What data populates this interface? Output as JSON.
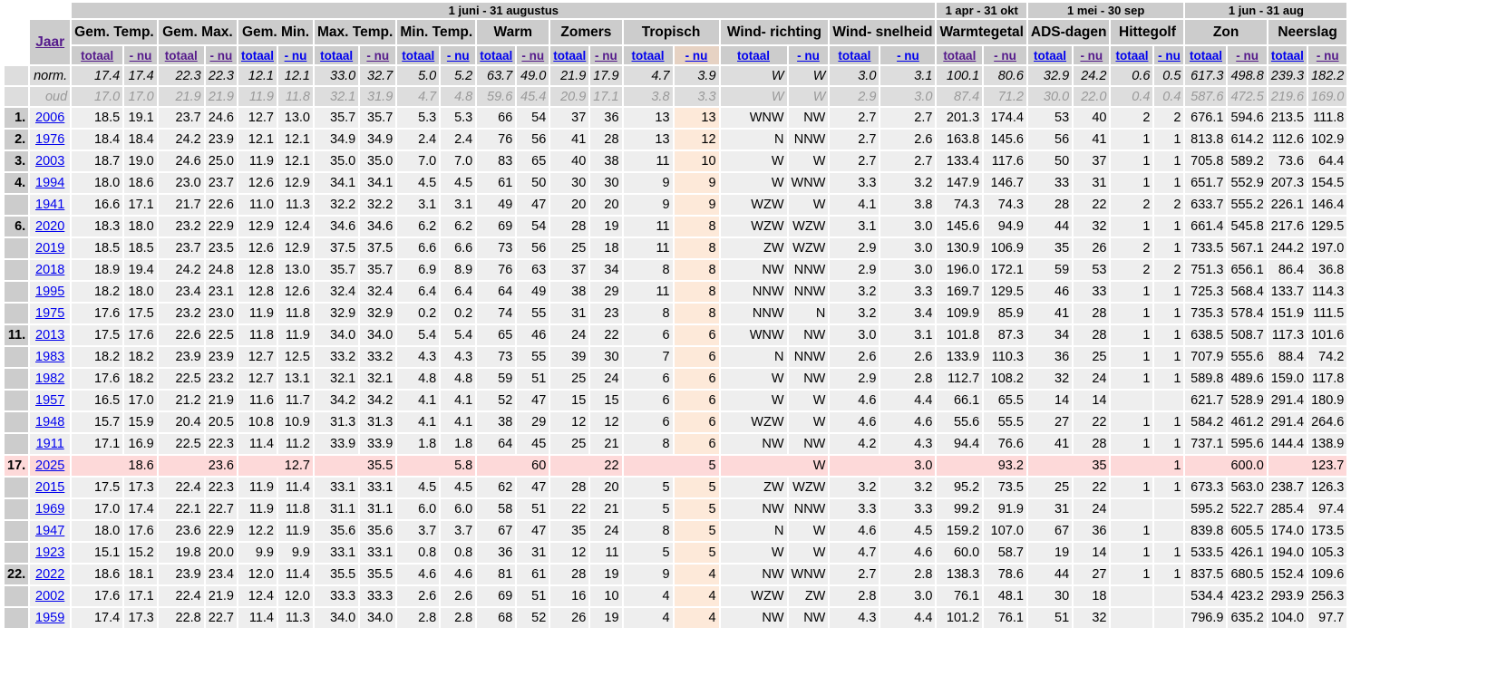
{
  "periods": [
    "1 juni - 31 augustus",
    "1 apr - 31 okt",
    "1 mei - 30 sep",
    "1 jun - 31 aug"
  ],
  "year_header": "Jaar",
  "groups": [
    "Gem. Temp.",
    "Gem. Max.",
    "Gem. Min.",
    "Max. Temp.",
    "Min. Temp.",
    "Warm",
    "Zomers",
    "Tropisch",
    "Wind- richting",
    "Wind- snelheid",
    "Warmtegetal",
    "ADS-dagen",
    "Hittegolf",
    "Zon",
    "Neerslag"
  ],
  "sub_labels": {
    "total": "totaal",
    "now": "- nu"
  },
  "visited_links": [
    [
      true,
      true
    ],
    [
      true,
      true
    ],
    [
      false,
      false
    ],
    [
      false,
      true
    ],
    [
      false,
      false
    ],
    [
      false,
      true
    ],
    [
      false,
      true
    ],
    [
      false,
      false
    ],
    [
      false,
      false
    ],
    [
      false,
      false
    ],
    [
      true,
      true
    ],
    [
      false,
      true
    ],
    [
      false,
      false
    ],
    [
      false,
      true
    ],
    [
      false,
      true
    ]
  ],
  "norm": {
    "label": "norm.",
    "values": [
      "17.4",
      "17.4",
      "22.3",
      "22.3",
      "12.1",
      "12.1",
      "33.0",
      "32.7",
      "5.0",
      "5.2",
      "63.7",
      "49.0",
      "21.9",
      "17.9",
      "4.7",
      "3.9",
      "W",
      "W",
      "3.0",
      "3.1",
      "100.1",
      "80.6",
      "32.9",
      "24.2",
      "0.6",
      "0.5",
      "617.3",
      "498.8",
      "239.3",
      "182.2"
    ]
  },
  "oud": {
    "label": "oud",
    "values": [
      "17.0",
      "17.0",
      "21.9",
      "21.9",
      "11.9",
      "11.8",
      "32.1",
      "31.9",
      "4.7",
      "4.8",
      "59.6",
      "45.4",
      "20.9",
      "17.1",
      "3.8",
      "3.3",
      "W",
      "W",
      "2.9",
      "3.0",
      "87.4",
      "71.2",
      "30.0",
      "22.0",
      "0.4",
      "0.4",
      "587.6",
      "472.5",
      "219.6",
      "169.0"
    ]
  },
  "colors": {
    "header": "#cccccc",
    "row": "#eeeeee",
    "highlight_row": "#fdd9d9",
    "tropisch_now": "#fde9d9"
  },
  "rows": [
    {
      "rank": "1.",
      "year": "2006",
      "values": [
        "18.5",
        "19.1",
        "23.7",
        "24.6",
        "12.7",
        "13.0",
        "35.7",
        "35.7",
        "5.3",
        "5.3",
        "66",
        "54",
        "37",
        "36",
        "13",
        "13",
        "WNW",
        "NW",
        "2.7",
        "2.7",
        "201.3",
        "174.4",
        "53",
        "40",
        "2",
        "2",
        "676.1",
        "594.6",
        "213.5",
        "111.8"
      ]
    },
    {
      "rank": "2.",
      "year": "1976",
      "values": [
        "18.4",
        "18.4",
        "24.2",
        "23.9",
        "12.1",
        "12.1",
        "34.9",
        "34.9",
        "2.4",
        "2.4",
        "76",
        "56",
        "41",
        "28",
        "13",
        "12",
        "N",
        "NNW",
        "2.7",
        "2.6",
        "163.8",
        "145.6",
        "56",
        "41",
        "1",
        "1",
        "813.8",
        "614.2",
        "112.6",
        "102.9"
      ]
    },
    {
      "rank": "3.",
      "year": "2003",
      "values": [
        "18.7",
        "19.0",
        "24.6",
        "25.0",
        "11.9",
        "12.1",
        "35.0",
        "35.0",
        "7.0",
        "7.0",
        "83",
        "65",
        "40",
        "38",
        "11",
        "10",
        "W",
        "W",
        "2.7",
        "2.7",
        "133.4",
        "117.6",
        "50",
        "37",
        "1",
        "1",
        "705.8",
        "589.2",
        "73.6",
        "64.4"
      ]
    },
    {
      "rank": "4.",
      "year": "1994",
      "values": [
        "18.0",
        "18.6",
        "23.0",
        "23.7",
        "12.6",
        "12.9",
        "34.1",
        "34.1",
        "4.5",
        "4.5",
        "61",
        "50",
        "30",
        "30",
        "9",
        "9",
        "W",
        "WNW",
        "3.3",
        "3.2",
        "147.9",
        "146.7",
        "33",
        "31",
        "1",
        "1",
        "651.7",
        "552.9",
        "207.3",
        "154.5"
      ]
    },
    {
      "rank": "",
      "year": "1941",
      "values": [
        "16.6",
        "17.1",
        "21.7",
        "22.6",
        "11.0",
        "11.3",
        "32.2",
        "32.2",
        "3.1",
        "3.1",
        "49",
        "47",
        "20",
        "20",
        "9",
        "9",
        "WZW",
        "W",
        "4.1",
        "3.8",
        "74.3",
        "74.3",
        "28",
        "22",
        "2",
        "2",
        "633.7",
        "555.2",
        "226.1",
        "146.4"
      ]
    },
    {
      "rank": "6.",
      "year": "2020",
      "values": [
        "18.3",
        "18.0",
        "23.2",
        "22.9",
        "12.9",
        "12.4",
        "34.6",
        "34.6",
        "6.2",
        "6.2",
        "69",
        "54",
        "28",
        "19",
        "11",
        "8",
        "WZW",
        "WZW",
        "3.1",
        "3.0",
        "145.6",
        "94.9",
        "44",
        "32",
        "1",
        "1",
        "661.4",
        "545.8",
        "217.6",
        "129.5"
      ]
    },
    {
      "rank": "",
      "year": "2019",
      "values": [
        "18.5",
        "18.5",
        "23.7",
        "23.5",
        "12.6",
        "12.9",
        "37.5",
        "37.5",
        "6.6",
        "6.6",
        "73",
        "56",
        "25",
        "18",
        "11",
        "8",
        "ZW",
        "WZW",
        "2.9",
        "3.0",
        "130.9",
        "106.9",
        "35",
        "26",
        "2",
        "1",
        "733.5",
        "567.1",
        "244.2",
        "197.0"
      ]
    },
    {
      "rank": "",
      "year": "2018",
      "values": [
        "18.9",
        "19.4",
        "24.2",
        "24.8",
        "12.8",
        "13.0",
        "35.7",
        "35.7",
        "6.9",
        "8.9",
        "76",
        "63",
        "37",
        "34",
        "8",
        "8",
        "NW",
        "NNW",
        "2.9",
        "3.0",
        "196.0",
        "172.1",
        "59",
        "53",
        "2",
        "2",
        "751.3",
        "656.1",
        "86.4",
        "36.8"
      ]
    },
    {
      "rank": "",
      "year": "1995",
      "values": [
        "18.2",
        "18.0",
        "23.4",
        "23.1",
        "12.8",
        "12.6",
        "32.4",
        "32.4",
        "6.4",
        "6.4",
        "64",
        "49",
        "38",
        "29",
        "11",
        "8",
        "NNW",
        "NNW",
        "3.2",
        "3.3",
        "169.7",
        "129.5",
        "46",
        "33",
        "1",
        "1",
        "725.3",
        "568.4",
        "133.7",
        "114.3"
      ]
    },
    {
      "rank": "",
      "year": "1975",
      "values": [
        "17.6",
        "17.5",
        "23.2",
        "23.0",
        "11.9",
        "11.8",
        "32.9",
        "32.9",
        "0.2",
        "0.2",
        "74",
        "55",
        "31",
        "23",
        "8",
        "8",
        "NNW",
        "N",
        "3.2",
        "3.4",
        "109.9",
        "85.9",
        "41",
        "28",
        "1",
        "1",
        "735.3",
        "578.4",
        "151.9",
        "111.5"
      ]
    },
    {
      "rank": "11.",
      "year": "2013",
      "values": [
        "17.5",
        "17.6",
        "22.6",
        "22.5",
        "11.8",
        "11.9",
        "34.0",
        "34.0",
        "5.4",
        "5.4",
        "65",
        "46",
        "24",
        "22",
        "6",
        "6",
        "WNW",
        "NW",
        "3.0",
        "3.1",
        "101.8",
        "87.3",
        "34",
        "28",
        "1",
        "1",
        "638.5",
        "508.7",
        "117.3",
        "101.6"
      ]
    },
    {
      "rank": "",
      "year": "1983",
      "values": [
        "18.2",
        "18.2",
        "23.9",
        "23.9",
        "12.7",
        "12.5",
        "33.2",
        "33.2",
        "4.3",
        "4.3",
        "73",
        "55",
        "39",
        "30",
        "7",
        "6",
        "N",
        "NNW",
        "2.6",
        "2.6",
        "133.9",
        "110.3",
        "36",
        "25",
        "1",
        "1",
        "707.9",
        "555.6",
        "88.4",
        "74.2"
      ]
    },
    {
      "rank": "",
      "year": "1982",
      "values": [
        "17.6",
        "18.2",
        "22.5",
        "23.2",
        "12.7",
        "13.1",
        "32.1",
        "32.1",
        "4.8",
        "4.8",
        "59",
        "51",
        "25",
        "24",
        "6",
        "6",
        "W",
        "NW",
        "2.9",
        "2.8",
        "112.7",
        "108.2",
        "32",
        "24",
        "1",
        "1",
        "589.8",
        "489.6",
        "159.0",
        "117.8"
      ]
    },
    {
      "rank": "",
      "year": "1957",
      "values": [
        "16.5",
        "17.0",
        "21.2",
        "21.9",
        "11.6",
        "11.7",
        "34.2",
        "34.2",
        "4.1",
        "4.1",
        "52",
        "47",
        "15",
        "15",
        "6",
        "6",
        "W",
        "W",
        "4.6",
        "4.4",
        "66.1",
        "65.5",
        "14",
        "14",
        "",
        "",
        "621.7",
        "528.9",
        "291.4",
        "180.9"
      ]
    },
    {
      "rank": "",
      "year": "1948",
      "values": [
        "15.7",
        "15.9",
        "20.4",
        "20.5",
        "10.8",
        "10.9",
        "31.3",
        "31.3",
        "4.1",
        "4.1",
        "38",
        "29",
        "12",
        "12",
        "6",
        "6",
        "WZW",
        "W",
        "4.6",
        "4.6",
        "55.6",
        "55.5",
        "27",
        "22",
        "1",
        "1",
        "584.2",
        "461.2",
        "291.4",
        "264.6"
      ]
    },
    {
      "rank": "",
      "year": "1911",
      "values": [
        "17.1",
        "16.9",
        "22.5",
        "22.3",
        "11.4",
        "11.2",
        "33.9",
        "33.9",
        "1.8",
        "1.8",
        "64",
        "45",
        "25",
        "21",
        "8",
        "6",
        "NW",
        "NW",
        "4.2",
        "4.3",
        "94.4",
        "76.6",
        "41",
        "28",
        "1",
        "1",
        "737.1",
        "595.6",
        "144.4",
        "138.9"
      ]
    },
    {
      "rank": "17.",
      "year": "2025",
      "current": true,
      "values": [
        "",
        "18.6",
        "",
        "23.6",
        "",
        "12.7",
        "",
        "35.5",
        "",
        "5.8",
        "",
        "60",
        "",
        "22",
        "",
        "5",
        "",
        "W",
        "",
        "3.0",
        "",
        "93.2",
        "",
        "35",
        "",
        "1",
        "",
        "600.0",
        "",
        "123.7"
      ]
    },
    {
      "rank": "",
      "year": "2015",
      "values": [
        "17.5",
        "17.3",
        "22.4",
        "22.3",
        "11.9",
        "11.4",
        "33.1",
        "33.1",
        "4.5",
        "4.5",
        "62",
        "47",
        "28",
        "20",
        "5",
        "5",
        "ZW",
        "WZW",
        "3.2",
        "3.2",
        "95.2",
        "73.5",
        "25",
        "22",
        "1",
        "1",
        "673.3",
        "563.0",
        "238.7",
        "126.3"
      ]
    },
    {
      "rank": "",
      "year": "1969",
      "values": [
        "17.0",
        "17.4",
        "22.1",
        "22.7",
        "11.9",
        "11.8",
        "31.1",
        "31.1",
        "6.0",
        "6.0",
        "58",
        "51",
        "22",
        "21",
        "5",
        "5",
        "NW",
        "NNW",
        "3.3",
        "3.3",
        "99.2",
        "91.9",
        "31",
        "24",
        "",
        "",
        "595.2",
        "522.7",
        "285.4",
        "97.4"
      ]
    },
    {
      "rank": "",
      "year": "1947",
      "values": [
        "18.0",
        "17.6",
        "23.6",
        "22.9",
        "12.2",
        "11.9",
        "35.6",
        "35.6",
        "3.7",
        "3.7",
        "67",
        "47",
        "35",
        "24",
        "8",
        "5",
        "N",
        "W",
        "4.6",
        "4.5",
        "159.2",
        "107.0",
        "67",
        "36",
        "1",
        "",
        "839.8",
        "605.5",
        "174.0",
        "173.5"
      ]
    },
    {
      "rank": "",
      "year": "1923",
      "values": [
        "15.1",
        "15.2",
        "19.8",
        "20.0",
        "9.9",
        "9.9",
        "33.1",
        "33.1",
        "0.8",
        "0.8",
        "36",
        "31",
        "12",
        "11",
        "5",
        "5",
        "W",
        "W",
        "4.7",
        "4.6",
        "60.0",
        "58.7",
        "19",
        "14",
        "1",
        "1",
        "533.5",
        "426.1",
        "194.0",
        "105.3"
      ]
    },
    {
      "rank": "22.",
      "year": "2022",
      "values": [
        "18.6",
        "18.1",
        "23.9",
        "23.4",
        "12.0",
        "11.4",
        "35.5",
        "35.5",
        "4.6",
        "4.6",
        "81",
        "61",
        "28",
        "19",
        "9",
        "4",
        "NW",
        "WNW",
        "2.7",
        "2.8",
        "138.3",
        "78.6",
        "44",
        "27",
        "1",
        "1",
        "837.5",
        "680.5",
        "152.4",
        "109.6"
      ]
    },
    {
      "rank": "",
      "year": "2002",
      "values": [
        "17.6",
        "17.1",
        "22.4",
        "21.9",
        "12.4",
        "12.0",
        "33.3",
        "33.3",
        "2.6",
        "2.6",
        "69",
        "51",
        "16",
        "10",
        "4",
        "4",
        "WZW",
        "ZW",
        "2.8",
        "3.0",
        "76.1",
        "48.1",
        "30",
        "18",
        "",
        "",
        "534.4",
        "423.2",
        "293.9",
        "256.3"
      ]
    },
    {
      "rank": "",
      "year": "1959",
      "values": [
        "17.4",
        "17.3",
        "22.8",
        "22.7",
        "11.4",
        "11.3",
        "34.0",
        "34.0",
        "2.8",
        "2.8",
        "68",
        "52",
        "26",
        "19",
        "4",
        "4",
        "NW",
        "NW",
        "4.3",
        "4.4",
        "101.2",
        "76.1",
        "51",
        "32",
        "",
        "",
        "796.9",
        "635.2",
        "104.0",
        "97.7"
      ]
    }
  ]
}
